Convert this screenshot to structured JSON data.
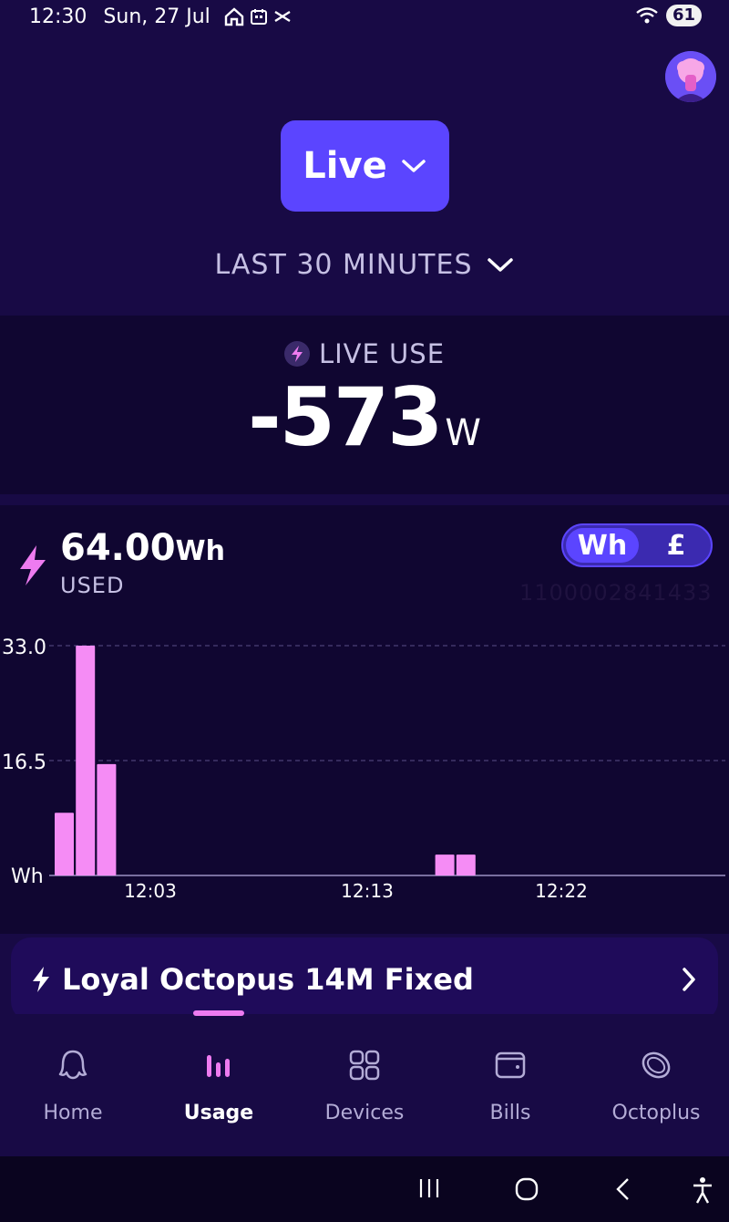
{
  "status": {
    "time": "12:30",
    "date": "Sun, 27 Jul",
    "battery": "61"
  },
  "header": {
    "mode_label": "Live",
    "period_label": "LAST 30 MINUTES"
  },
  "live": {
    "label": "LIVE USE",
    "value": "-573",
    "unit": "W"
  },
  "usage": {
    "total": "64.00",
    "total_unit": "Wh",
    "used_label": "USED",
    "toggle_wh": "Wh",
    "toggle_gbp": "£",
    "meter_id": "1100002841433"
  },
  "chart_data": {
    "type": "bar",
    "ylabel": "Wh",
    "y_ticks": [
      "33.0",
      "16.5"
    ],
    "x_ticks": [
      "12:03",
      "12:13",
      "12:22"
    ],
    "ylim": [
      0,
      33.0
    ],
    "bar_color": "#f58cf5",
    "values": [
      9,
      33.0,
      16,
      0,
      0,
      0,
      0,
      0,
      0,
      0,
      0,
      0,
      0,
      0,
      0,
      0,
      0,
      0,
      3,
      3
    ]
  },
  "tariff": {
    "name": "Loyal Octopus 14M Fixed"
  },
  "nav": {
    "items": [
      {
        "label": "Home"
      },
      {
        "label": "Usage"
      },
      {
        "label": "Devices"
      },
      {
        "label": "Bills"
      },
      {
        "label": "Octoplus"
      }
    ]
  },
  "colors": {
    "background": "#180a45",
    "panel": "#100631",
    "accent": "#5b45ff",
    "pink": "#f58cf5"
  }
}
